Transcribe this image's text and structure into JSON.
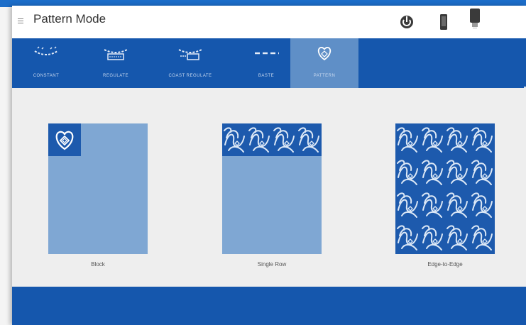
{
  "header": {
    "title": "Pattern Mode",
    "icons": [
      "menu-icon",
      "power-icon",
      "phone-icon",
      "usb-icon"
    ]
  },
  "tabs": [
    {
      "label": "CONSTANT",
      "icon": "constant-stitch-icon",
      "active": false
    },
    {
      "label": "REGULATE",
      "icon": "regulate-stitch-icon",
      "active": false
    },
    {
      "label": "COAST REGULATE",
      "icon": "coast-regulate-icon",
      "active": false
    },
    {
      "label": "BASTE",
      "icon": "baste-icon",
      "active": false
    },
    {
      "label": "PATTERN",
      "icon": "pattern-heart-icon",
      "active": true
    }
  ],
  "options": [
    {
      "label": "Block",
      "preview": "block-icon"
    },
    {
      "label": "Single Row",
      "preview": "single-row-icon"
    },
    {
      "label": "Edge-to-Edge",
      "preview": "edge-to-edge-icon"
    }
  ],
  "colors": {
    "primary": "#1557ad",
    "active_tab": "#5f8fc7",
    "preview_light": "#7fa7d3",
    "preview_dark": "#1d5aad"
  }
}
